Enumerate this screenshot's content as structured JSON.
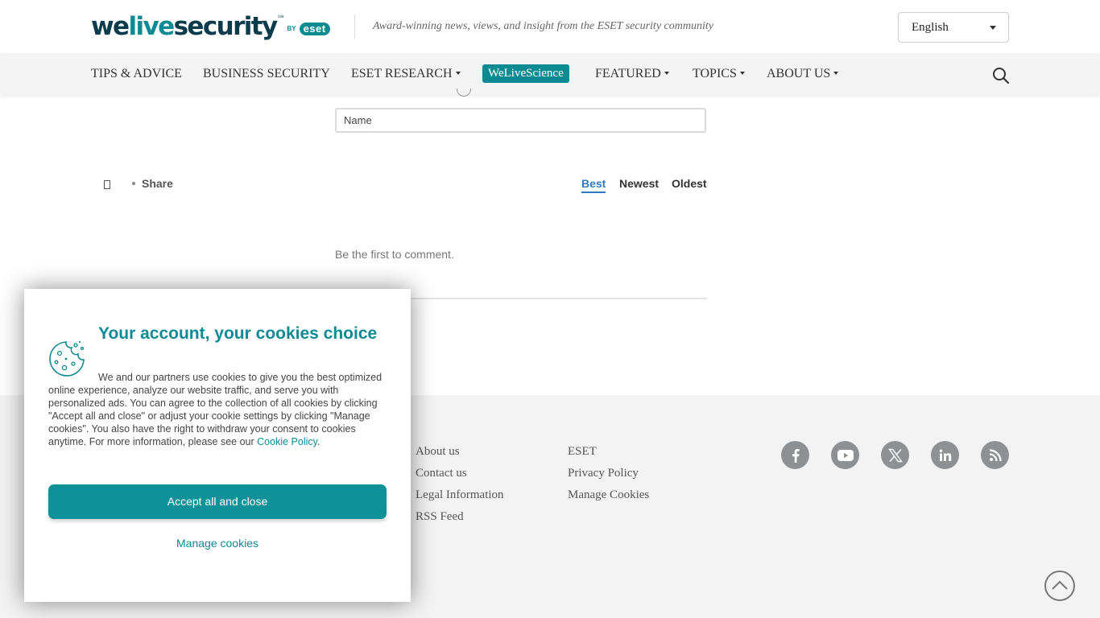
{
  "header": {
    "logo": {
      "we": "we",
      "live": "live",
      "security": "security",
      "tm": "™",
      "by": "BY",
      "eset": "eset"
    },
    "tagline": "Award-winning news, views, and insight from the ESET security community",
    "language": "English"
  },
  "nav": {
    "items": [
      {
        "label": "TIPS & ADVICE",
        "dropdown": false
      },
      {
        "label": "BUSINESS SECURITY",
        "dropdown": false
      },
      {
        "label": "ESET RESEARCH",
        "dropdown": true
      },
      {
        "label": "WeLiveScience",
        "highlighted": true
      },
      {
        "label": "FEATURED",
        "dropdown": true
      },
      {
        "label": "TOPICS",
        "dropdown": true
      },
      {
        "label": "ABOUT US",
        "dropdown": true
      }
    ],
    "search_icon": "search-icon"
  },
  "comments": {
    "name_placeholder": "Name",
    "share_label": "Share",
    "sort_options": [
      "Best",
      "Newest",
      "Oldest"
    ],
    "active_sort": "Best",
    "empty_text": "Be the first to comment."
  },
  "footer": {
    "col1": [
      "About us",
      "Contact us",
      "Legal Information",
      "RSS Feed"
    ],
    "col2": [
      "ESET",
      "Privacy Policy",
      "Manage Cookies"
    ],
    "social": [
      "facebook-icon",
      "youtube-icon",
      "x-icon",
      "linkedin-icon",
      "rss-icon"
    ]
  },
  "cookie_dialog": {
    "title": "Your account, your cookies choice",
    "body": "We and our partners use cookies to give you the best optimized online experience, analyze our website traffic, and serve you with personalized ads. You can agree to the collection of all cookies by clicking \"Accept all and close\" or adjust your cookie settings by clicking \"Manage cookies\". You also have the right to withdraw your consent to cookies anytime. For more information, please see our ",
    "policy_link": "Cookie Policy",
    "policy_end": ".",
    "accept_label": "Accept all and close",
    "manage_label": "Manage cookies"
  },
  "colors": {
    "brand": "#0e8a93",
    "brand_dark": "#0c3c4c",
    "sort_active": "#2e7bc4"
  }
}
